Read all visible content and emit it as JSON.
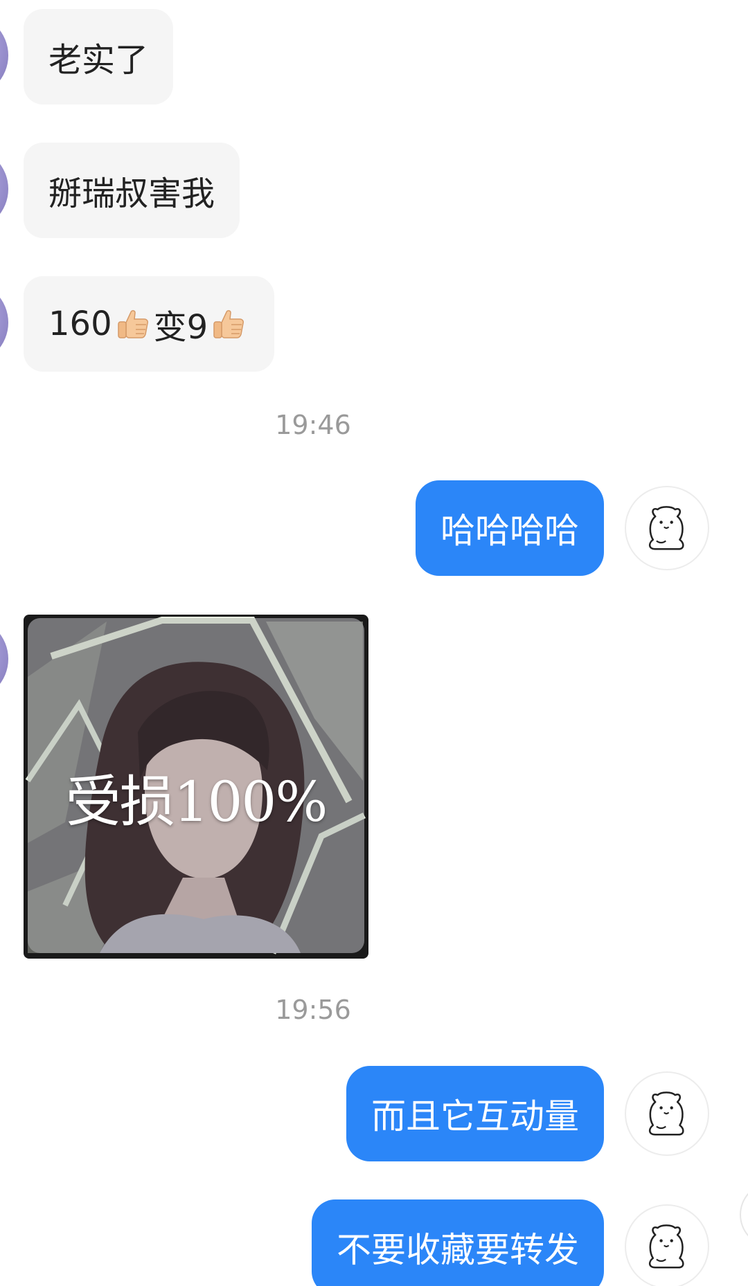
{
  "conversation": {
    "messages": [
      {
        "side": "left",
        "type": "text",
        "text": "老实了"
      },
      {
        "side": "left",
        "type": "text",
        "text": "掰瑞叔害我"
      },
      {
        "side": "left",
        "type": "text",
        "parts": [
          "160",
          "👍",
          "变9",
          "👍"
        ]
      },
      {
        "type": "timestamp",
        "text": "19:46"
      },
      {
        "side": "right",
        "type": "text",
        "text": "哈哈哈哈"
      },
      {
        "side": "left",
        "type": "image",
        "caption": "受损100%"
      },
      {
        "type": "timestamp",
        "text": "19:56"
      },
      {
        "side": "right",
        "type": "text",
        "text": "而且它互动量"
      },
      {
        "side": "right",
        "type": "text",
        "text": "不要收藏要转发"
      }
    ]
  },
  "icons": {
    "left_avatar": "contact-avatar",
    "right_avatar": "bear-sticker-avatar",
    "reaction": "thumbs-up-emoji"
  },
  "colors": {
    "outgoing_bubble": "#2b86f8",
    "incoming_bubble": "#f5f5f5",
    "timestamp": "#9a9a9a"
  }
}
